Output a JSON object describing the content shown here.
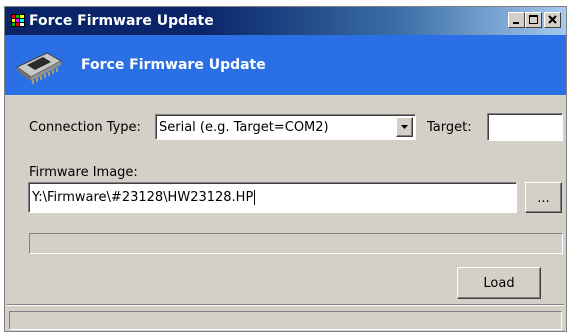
{
  "window": {
    "title": "Force Firmware Update",
    "controls": [
      "minimize-icon",
      "maximize-icon",
      "close-icon"
    ]
  },
  "banner": {
    "icon": "memory-chip-icon",
    "title": "Force Firmware Update"
  },
  "connection": {
    "label": "Connection Type:",
    "selected": "Serial (e.g. Target=COM2)",
    "target_label": "Target:",
    "target_value": ""
  },
  "firmware": {
    "label": "Firmware Image:",
    "path": "Y:\\Firmware\\#23128\\HW23128.HP",
    "browse_label": "..."
  },
  "progress": {
    "value": 0
  },
  "actions": {
    "load_label": "Load"
  },
  "status": {
    "text": ""
  },
  "colors": {
    "titlebar": "#0a246a",
    "banner": "#2b6fe6",
    "face": "#d4d0c8"
  }
}
